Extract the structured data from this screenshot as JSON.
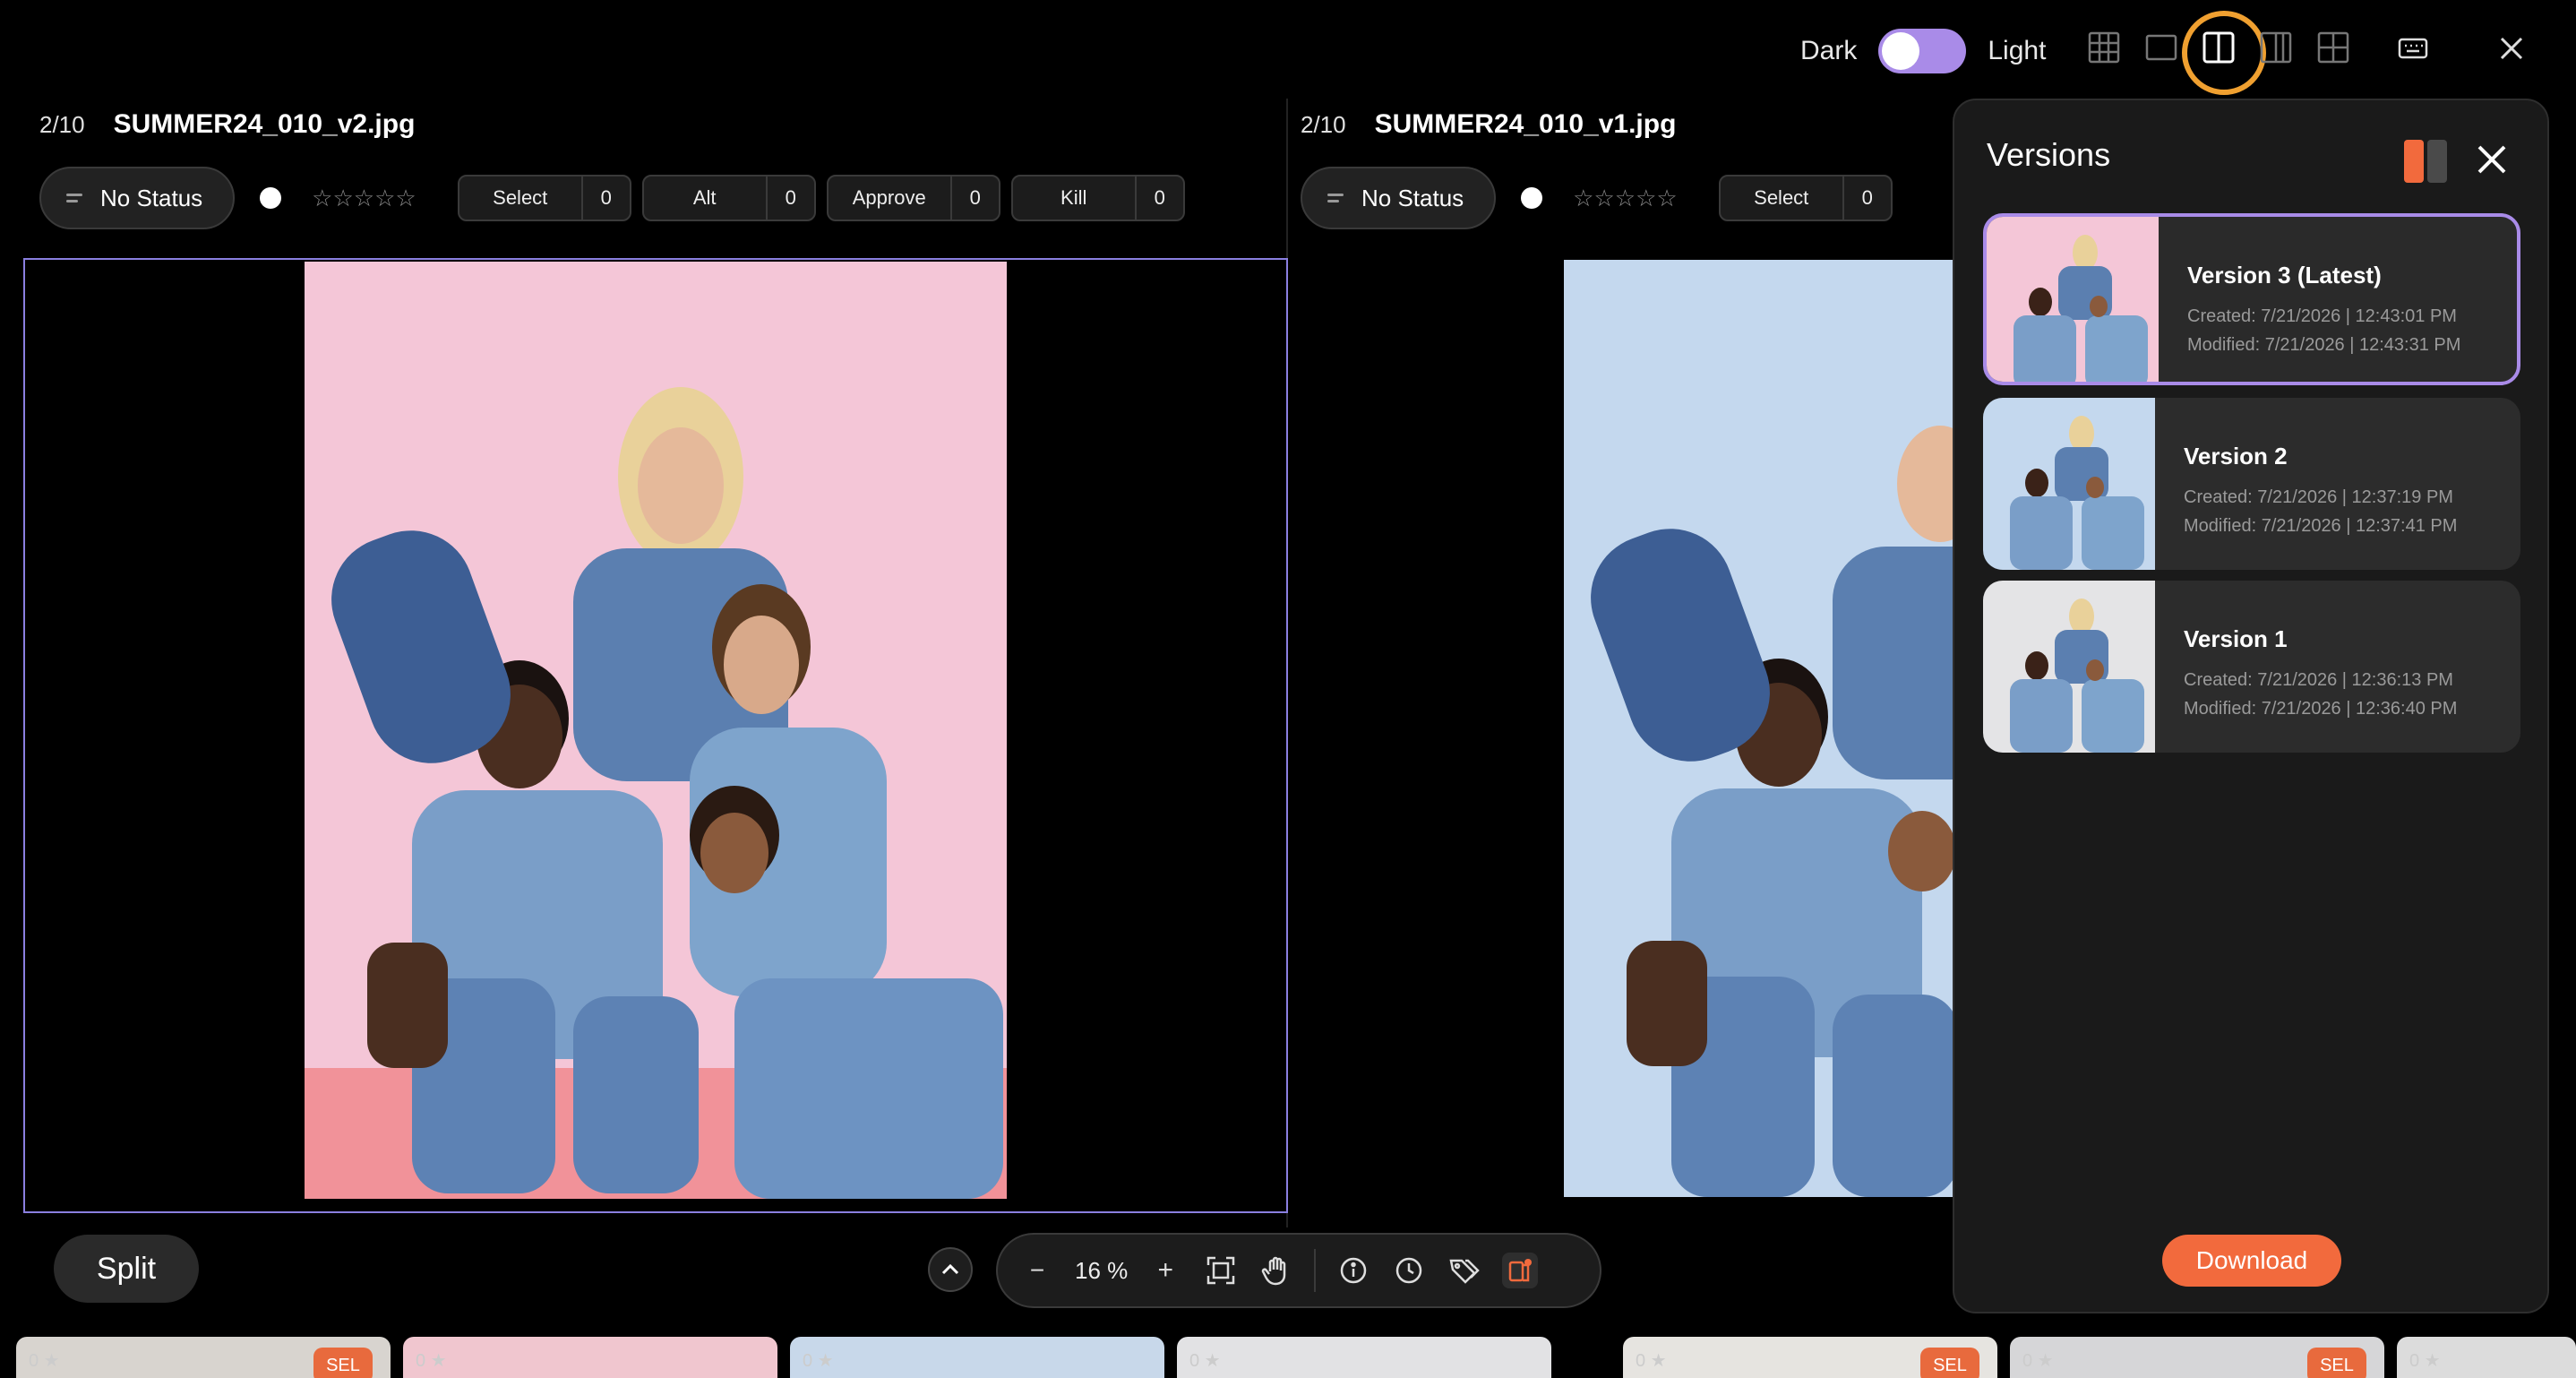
{
  "theme": {
    "dark_label": "Dark",
    "light_label": "Light"
  },
  "left_pane": {
    "counter": "2/10",
    "filename": "SUMMER24_010_v2.jpg",
    "status": "No Status",
    "rating": "☆☆☆☆☆",
    "tags": [
      {
        "label": "Select",
        "count": "0"
      },
      {
        "label": "Alt",
        "count": "0"
      },
      {
        "label": "Approve",
        "count": "0"
      },
      {
        "label": "Kill",
        "count": "0"
      }
    ]
  },
  "right_pane": {
    "counter": "2/10",
    "filename": "SUMMER24_010_v1.jpg",
    "status": "No Status",
    "rating": "☆☆☆☆☆",
    "tags": [
      {
        "label": "Select",
        "count": "0"
      }
    ]
  },
  "versions_panel": {
    "title": "Versions",
    "versions": [
      {
        "name": "Version 3 (Latest)",
        "created": "Created: 7/21/2026 | 12:43:01 PM",
        "modified": "Modified: 7/21/2026 | 12:43:31 PM",
        "bg": "#f4c6d7"
      },
      {
        "name": "Version 2",
        "created": "Created: 7/21/2026 | 12:37:19 PM",
        "modified": "Modified: 7/21/2026 | 12:37:41 PM",
        "bg": "#c4d8ee"
      },
      {
        "name": "Version 1",
        "created": "Created: 7/21/2026 | 12:36:13 PM",
        "modified": "Modified: 7/21/2026 | 12:36:40 PM",
        "bg": "#e4e4e6"
      }
    ],
    "download_label": "Download"
  },
  "toolbar": {
    "split_label": "Split",
    "zoom_minus": "−",
    "zoom_value": "16 %",
    "zoom_plus": "+"
  },
  "filmstrip": [
    {
      "rating": "0 ★",
      "badge": "SEL"
    },
    {
      "rating": "0 ★",
      "badge": ""
    },
    {
      "rating": "0 ★",
      "badge": ""
    },
    {
      "rating": "0 ★",
      "badge": ""
    },
    {
      "rating": "0 ★",
      "badge": "SEL"
    },
    {
      "rating": "0 ★",
      "badge": "SEL"
    },
    {
      "rating": "0 ★",
      "badge": ""
    }
  ],
  "colors": {
    "accent_orange": "#f26a3d",
    "selection_purple": "#a98be8",
    "highlight_ring": "#f0a030",
    "left_photo_bg": "#f4c6d7",
    "right_photo_bg": "#c4d8ee"
  }
}
